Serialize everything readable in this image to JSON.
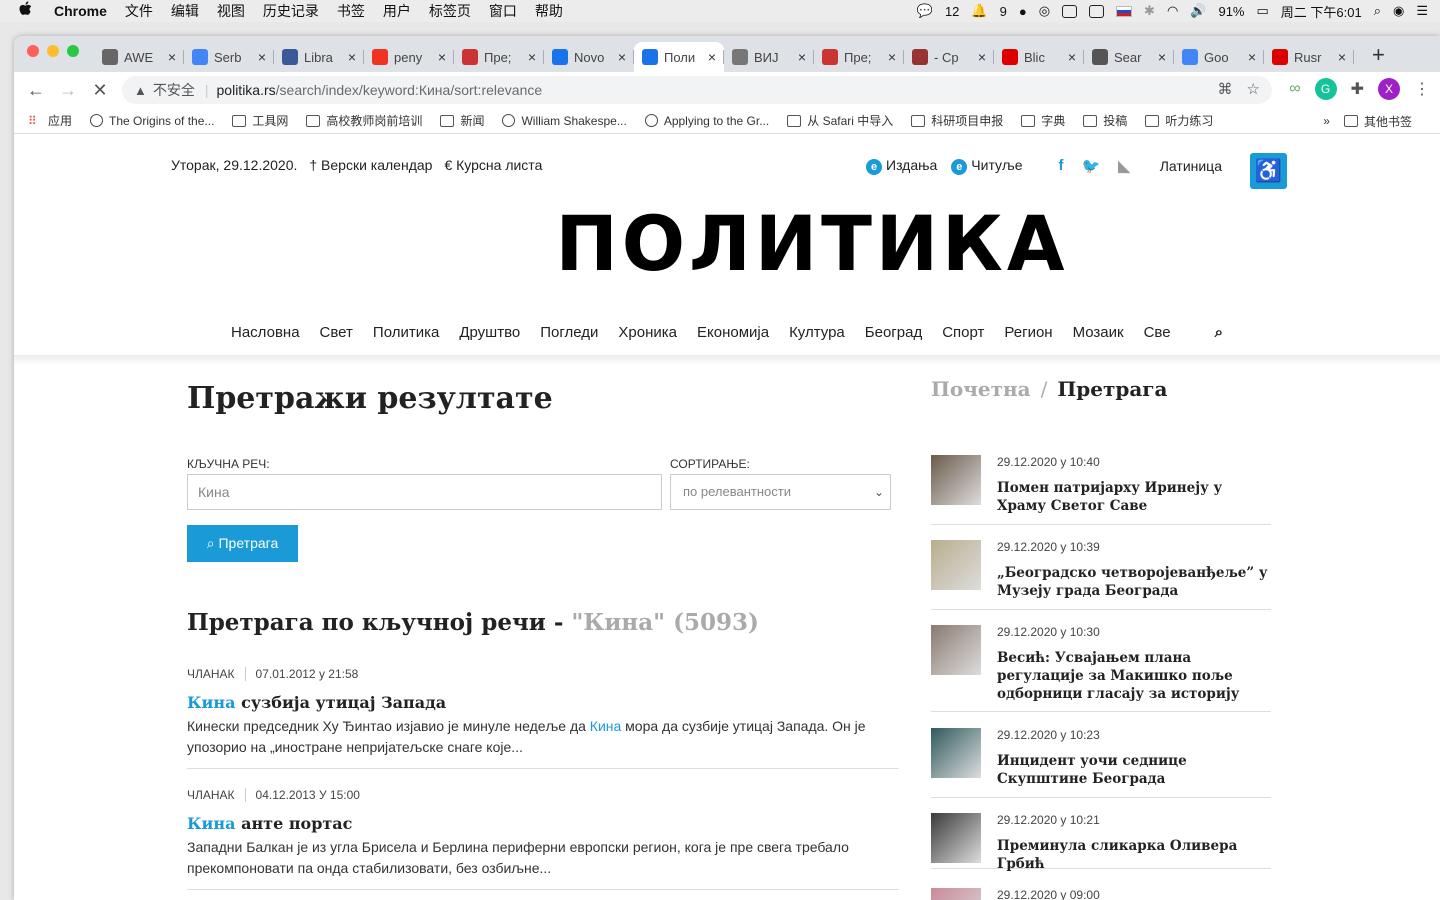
{
  "menubar": {
    "apple": "",
    "app": "Chrome",
    "items": [
      "文件",
      "编辑",
      "视图",
      "历史记录",
      "书签",
      "用户",
      "标签页",
      "窗口",
      "帮助"
    ],
    "wechat_count": "12",
    "notif_count": "9",
    "battery": "91%",
    "datetime": "周二 下午6:01"
  },
  "tabs": [
    {
      "title": "AWE",
      "color": "#666"
    },
    {
      "title": "Serb",
      "color": "#4285f4"
    },
    {
      "title": "Libra",
      "color": "#3b5998"
    },
    {
      "title": "peny",
      "color": "#e32"
    },
    {
      "title": "Пре;",
      "color": "#c33"
    },
    {
      "title": "Novo",
      "color": "#1a73e8"
    },
    {
      "title": "Поли",
      "color": "#1a73e8"
    },
    {
      "title": "ВИЈ",
      "color": "#777"
    },
    {
      "title": "Пре;",
      "color": "#c33"
    },
    {
      "title": "- Ср",
      "color": "#933"
    },
    {
      "title": "Blic",
      "color": "#d00"
    },
    {
      "title": "Sear",
      "color": "#555"
    },
    {
      "title": "Goo",
      "color": "#4285f4"
    },
    {
      "title": "Rusr",
      "color": "#d00"
    }
  ],
  "tab_close": "×",
  "new_tab": "+",
  "address": {
    "insecure": "不安全",
    "host": "politika.rs",
    "path": "/search/index/keyword:Кина/sort:relevance"
  },
  "profile_initial": "X",
  "bookmarks": [
    {
      "label": "应用",
      "kind": "apps"
    },
    {
      "label": "The Origins of the...",
      "kind": "site"
    },
    {
      "label": "工具网",
      "kind": "folder"
    },
    {
      "label": "高校教师岗前培训",
      "kind": "folder"
    },
    {
      "label": "新闻",
      "kind": "folder"
    },
    {
      "label": "William Shakespe...",
      "kind": "site"
    },
    {
      "label": "Applying to the Gr...",
      "kind": "site"
    },
    {
      "label": "从 Safari 中导入",
      "kind": "folder"
    },
    {
      "label": "科研项目申报",
      "kind": "folder"
    },
    {
      "label": "字典",
      "kind": "folder"
    },
    {
      "label": "投稿",
      "kind": "folder"
    },
    {
      "label": "听力练习",
      "kind": "folder"
    }
  ],
  "bookmarks_more": "»",
  "bookmarks_other": "其他书签",
  "site": {
    "date": "Уторак, 29.12.2020.",
    "calendar": "† Верски календар",
    "exchange": "€ Курсна листа",
    "editions": "Издања",
    "obituaries": "Читуље",
    "latin": "Латиница",
    "logo": "ПОЛИТИКА",
    "nav": [
      "Насловна",
      "Свет",
      "Политика",
      "Друштво",
      "Погледи",
      "Хроника",
      "Економија",
      "Култура",
      "Београд",
      "Спорт",
      "Регион",
      "Мозаик",
      "Све"
    ]
  },
  "search": {
    "heading": "Претражи резултате",
    "keyword_label": "КЉУЧНА РЕЧ:",
    "keyword_value": "Кина",
    "sort_label": "СОРТИРАЊЕ:",
    "sort_value": "по релевантности",
    "button": "Претрага",
    "results_heading": "Претрага по кључној речи - ",
    "results_query": "\"Кина\" (5093)"
  },
  "results": [
    {
      "type": "ЧЛАНАК",
      "date": "07.01.2012 у 21:58",
      "title_hl": "Кина",
      "title_rest": " сузбија утицај Запада",
      "snip_a": "Кинески председник Ху Ђинтао изјавио је минуле недеље да ",
      "snip_hl": "Кина",
      "snip_b": " мора да сузбије утицај Запада. Он је упозорио на „иностране непријатељске снаге које..."
    },
    {
      "type": "ЧЛАНАК",
      "date": "04.12.2013 У 15:00",
      "title_hl": "Кина",
      "title_rest": " анте портас",
      "snip_a": "Западни Балкан је из угла Брисела и Берлина периферни европски регион, кога је пре свега требало прекомпоновати па онда стабилизовати, без озбиљне...",
      "snip_hl": "",
      "snip_b": ""
    }
  ],
  "breadcrumb": {
    "home": "Почетна",
    "sep": "/",
    "current": "Претрага"
  },
  "news": [
    {
      "time": "29.12.2020 у 10:40",
      "title": "Помен патријарху Иринеју у Храму Светог Саве",
      "thumb": "#6b5a4a"
    },
    {
      "time": "29.12.2020 у 10:39",
      "title": "„Београдско четворојеванђеље” у Музеју града Београда",
      "thumb": "#b9ad8c"
    },
    {
      "time": "29.12.2020 у 10:30",
      "title": "Весић: Усвајањем плана регулације за Макишко поље одборници гласају за историју",
      "thumb": "#8a7a70"
    },
    {
      "time": "29.12.2020 у 10:23",
      "title": "Инцидент уочи седнице Скупштине Београда",
      "thumb": "#2f5a5e"
    },
    {
      "time": "29.12.2020 у 10:21",
      "title": "Преминула сликарка Оливера Грбић",
      "thumb": "#3a3a3a"
    },
    {
      "time": "29.12.2020 у 09:00",
      "title": "",
      "thumb": "#c98a9a"
    }
  ]
}
